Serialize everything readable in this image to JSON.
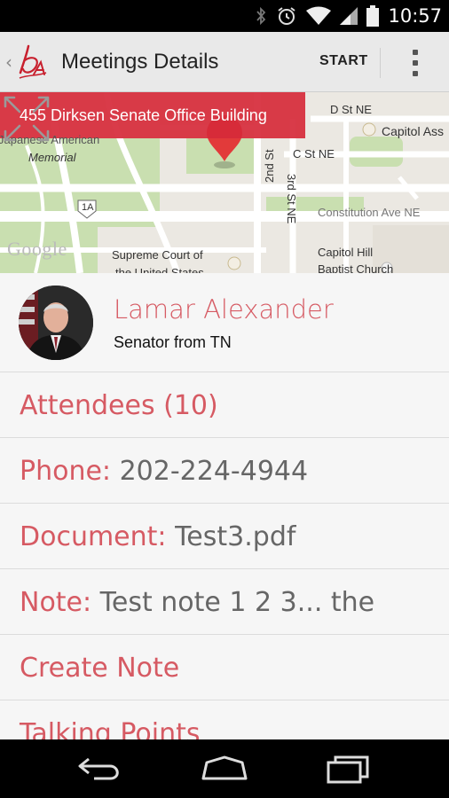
{
  "status_bar": {
    "time": "10:57",
    "icons": [
      "bluetooth-icon",
      "alarm-icon",
      "wifi-icon",
      "signal-icon",
      "battery-icon"
    ]
  },
  "action_bar": {
    "title": "Meetings Details",
    "start_label": "START",
    "icons": [
      "up-caret-icon",
      "app-logo",
      "overflow-menu-icon"
    ]
  },
  "map": {
    "address": "455 Dirksen Senate Office Building",
    "labels": {
      "japanese_memorial_1": "Japanese American",
      "japanese_memorial_2": "Memorial",
      "d_st": "D St NE",
      "capitol": "Capitol Ass",
      "c_st": "C St NE",
      "second_st": "2nd St",
      "third_st": "3rd St NE",
      "constitution": "Constitution Ave NE",
      "route": "1A",
      "supreme_1": "Supreme Court of",
      "supreme_2": "the United States",
      "church_1": "Capitol Hill",
      "church_2": "Baptist Church",
      "google": "Google"
    }
  },
  "senator": {
    "name": "Lamar Alexander",
    "subtitle": "Senator from TN"
  },
  "rows": {
    "attendees": {
      "label": "Attendees (10)"
    },
    "phone": {
      "label": "Phone: ",
      "value": "202-224-4944"
    },
    "document": {
      "label": "Document: ",
      "value": "Test3.pdf"
    },
    "note": {
      "label": "Note: ",
      "value": "Test note 1 2 3... the"
    },
    "create_note": {
      "label": "Create Note"
    },
    "talking_points": {
      "label": "Talking Points"
    }
  },
  "colors": {
    "accent": "#d65a63",
    "banner": "#d62a3a",
    "actionbar": "#e9e9e9"
  }
}
